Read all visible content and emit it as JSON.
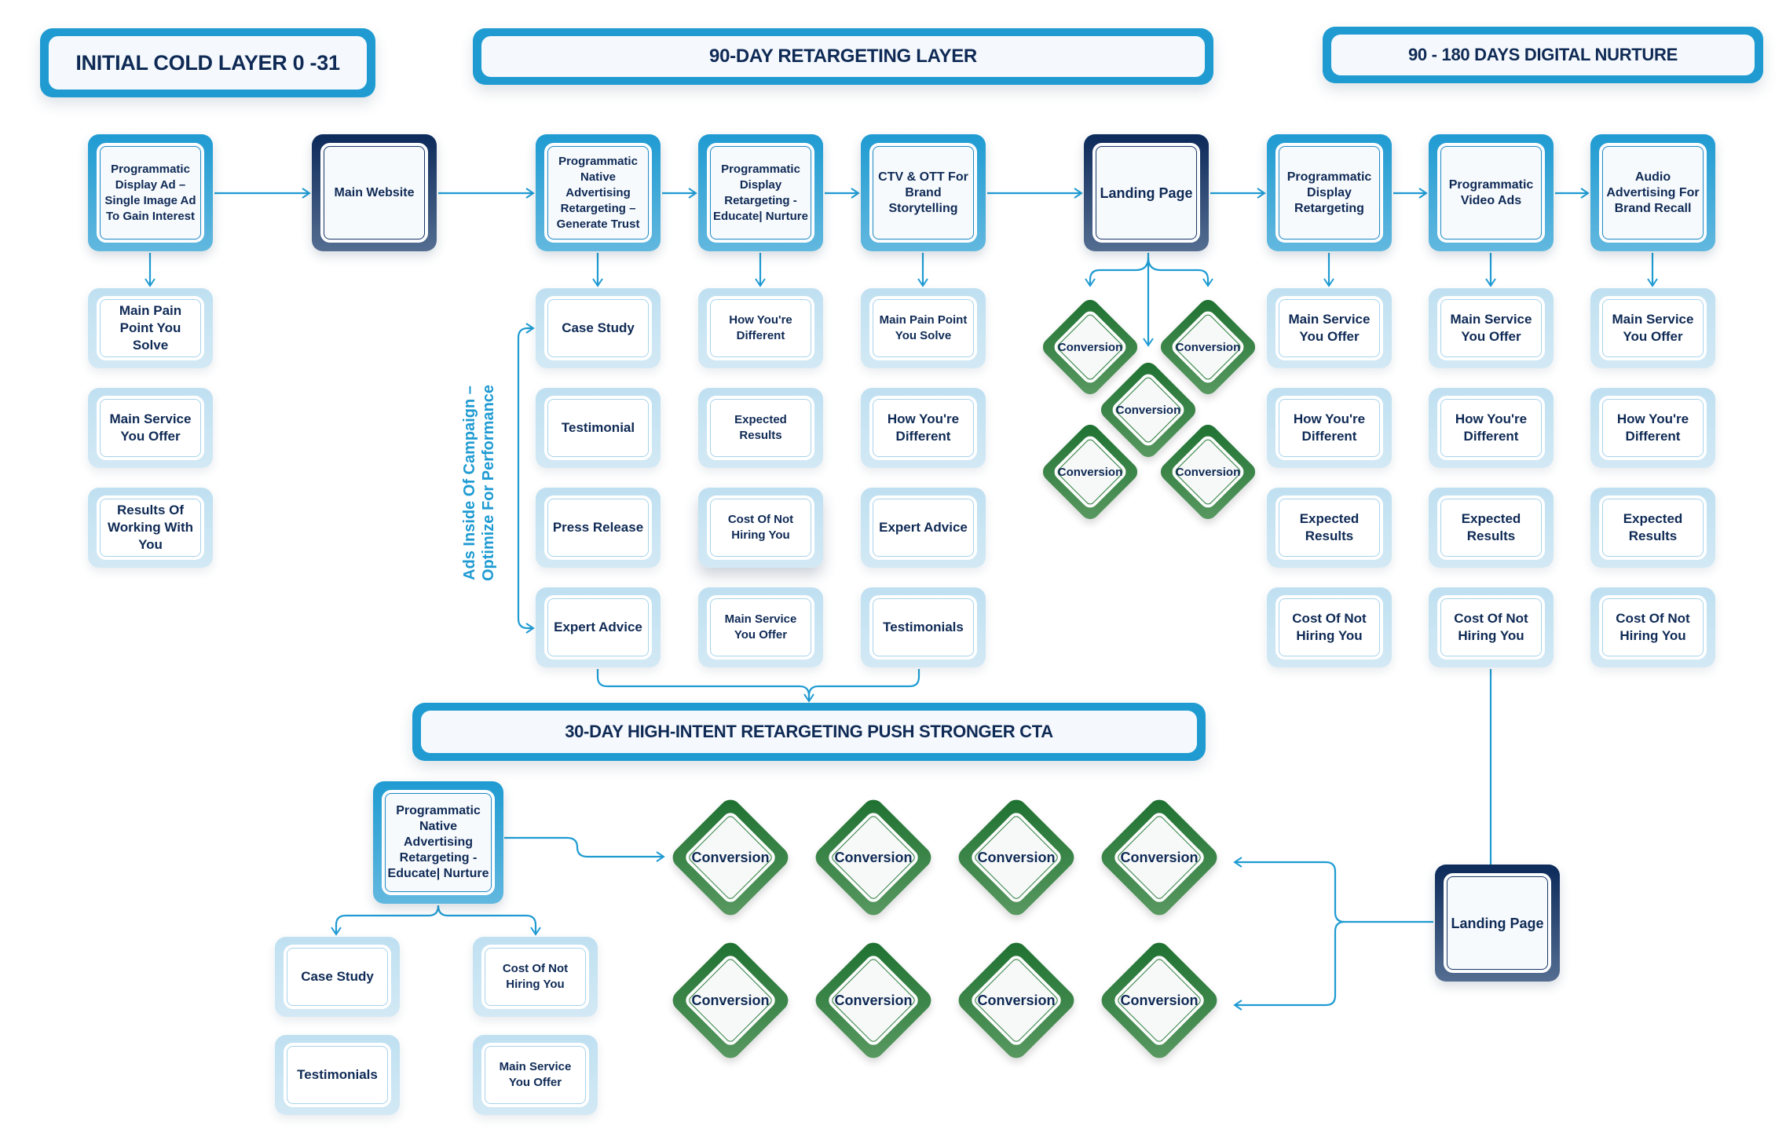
{
  "colors": {
    "accent_blue": "#1f9bd2",
    "navy_text": "#0f2a55",
    "dark_box": "#0c2a5a",
    "conversion_green": "#1d7030",
    "sub_box_fill": "#c8e4f3"
  },
  "headers": {
    "initial_cold": "INITIAL COLD LAYER 0 -31",
    "retargeting_90": "90-DAY RETARGETING LAYER",
    "nurture_90_180": "90 - 180 DAYS DIGITAL NURTURE",
    "high_intent_30": "30-DAY HIGH-INTENT RETARGETING PUSH STRONGER CTA"
  },
  "side_label": {
    "line1": "Ads Inside Of Campaign –",
    "line2": "Optimize For Performance"
  },
  "top_row": [
    {
      "label": "Programmatic Display Ad – Single Image Ad To Gain Interest",
      "style": "blue",
      "subs": [
        "Main Pain Point You Solve",
        "Main Service You Offer",
        "Results Of Working With You"
      ]
    },
    {
      "label": "Main Website",
      "style": "dark",
      "subs": []
    },
    {
      "label": "Programmatic Native Advertising Retargeting – Generate Trust",
      "style": "blue",
      "subs": [
        "Case Study",
        "Testimonial",
        "Press Release",
        "Expert Advice"
      ]
    },
    {
      "label": "Programmatic Display Retargeting - Educate| Nurture",
      "style": "blue",
      "subs": [
        "How You're Different",
        "Expected Results",
        "Cost Of Not Hiring You",
        "Main Service You Offer"
      ]
    },
    {
      "label": "CTV & OTT For Brand Storytelling",
      "style": "blue",
      "subs": [
        "Main Pain Point You Solve",
        "How You're Different",
        "Expert Advice",
        "Testimonials"
      ]
    },
    {
      "label": "Landing Page",
      "style": "dark",
      "subs": []
    },
    {
      "label": "Programmatic Display Retargeting",
      "style": "blue",
      "subs": [
        "Main Service You Offer",
        "How You're Different",
        "Expected Results",
        "Cost Of Not Hiring You"
      ]
    },
    {
      "label": "Programmatic Video Ads",
      "style": "blue",
      "subs": [
        "Main Service You Offer",
        "How You're Different",
        "Expected Results",
        "Cost Of Not Hiring You"
      ]
    },
    {
      "label": "Audio Advertising For Brand Recall",
      "style": "blue",
      "subs": [
        "Main Service You Offer",
        "How You're Different",
        "Expected Results",
        "Cost Of Not Hiring You"
      ]
    }
  ],
  "landing_conversions": [
    "Conversion",
    "Conversion",
    "Conversion",
    "Conversion",
    "Conversion"
  ],
  "bottom": {
    "native_box": "Programmatic Native Advertising Retargeting - Educate| Nurture",
    "subs": [
      "Case Study",
      "Cost Of Not Hiring You",
      "Testimonials",
      "Main Service You Offer"
    ],
    "conversions": [
      "Conversion",
      "Conversion",
      "Conversion",
      "Conversion",
      "Conversion",
      "Conversion",
      "Conversion",
      "Conversion"
    ],
    "landing_page": "Landing Page"
  }
}
